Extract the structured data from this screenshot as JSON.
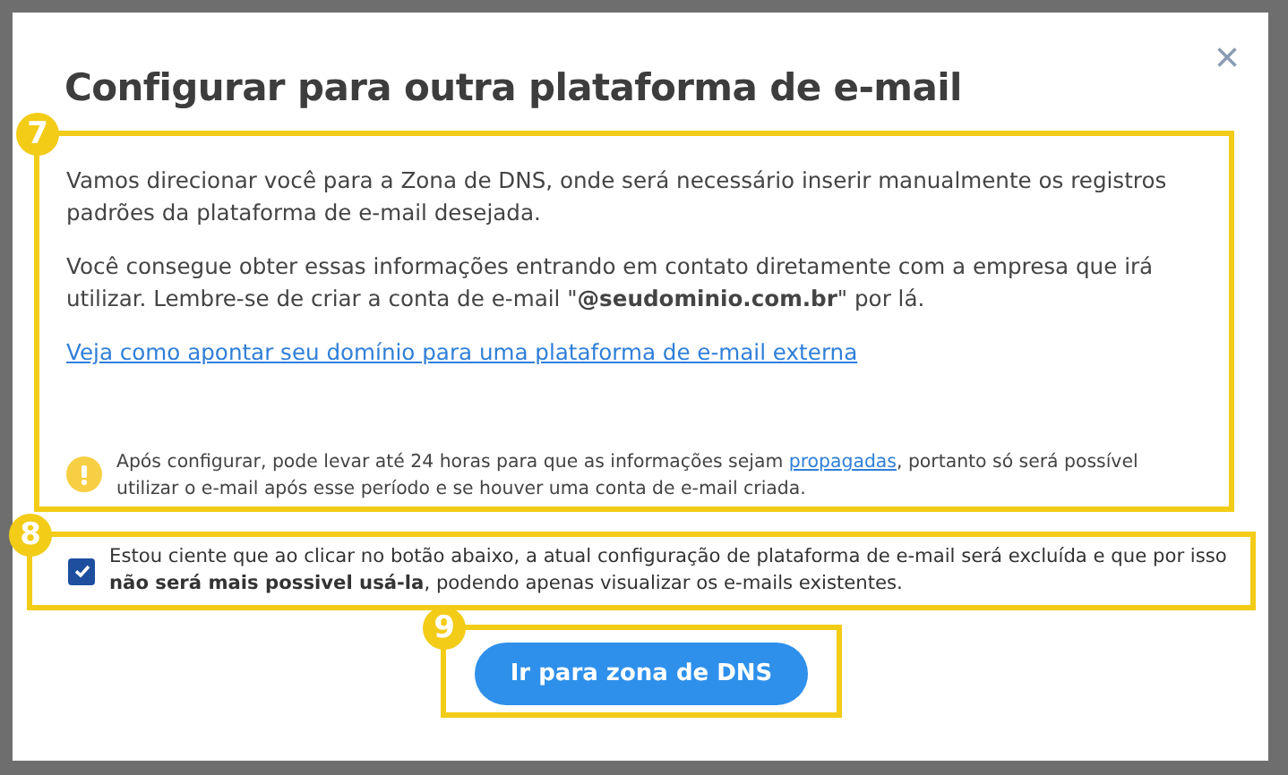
{
  "dialog": {
    "title": "Configurar para outra plataforma de e-mail",
    "close": "×",
    "section": {
      "badge": "7",
      "paragraphs": [
        "Vamos direcionar você para a Zona de DNS, onde será necessário inserir manualmente os registros padrões da plataforma de e-mail desejada.",
        "Você consegue obter essas informações entrando em contato diretamente com a empresa que irá utilizar. Lembre-se de criar a conta de e-mail \"**@seudominio.com.br**\" por lá."
      ],
      "link": "Veja como apontar seu domínio para uma plataforma de e-mail externa",
      "notice": {
        "before": "Após configurar, pode levar até 24 horas para que as informações sejam ",
        "link": "propagadas",
        "after": ", portanto só será possível utilizar o e-mail após esse período e se houver uma conta de e-mail criada."
      }
    },
    "consent": {
      "badge": "8",
      "checked": true,
      "text": "Estou ciente que ao clicar no botão abaixo, a atual configuração de plataforma de e-mail será excluída e que por isso **não será mais possivel usá-la**, podendo apenas visualizar os e-mails existentes."
    },
    "action": {
      "badge": "9",
      "label": "Ir para zona de DNS"
    }
  }
}
